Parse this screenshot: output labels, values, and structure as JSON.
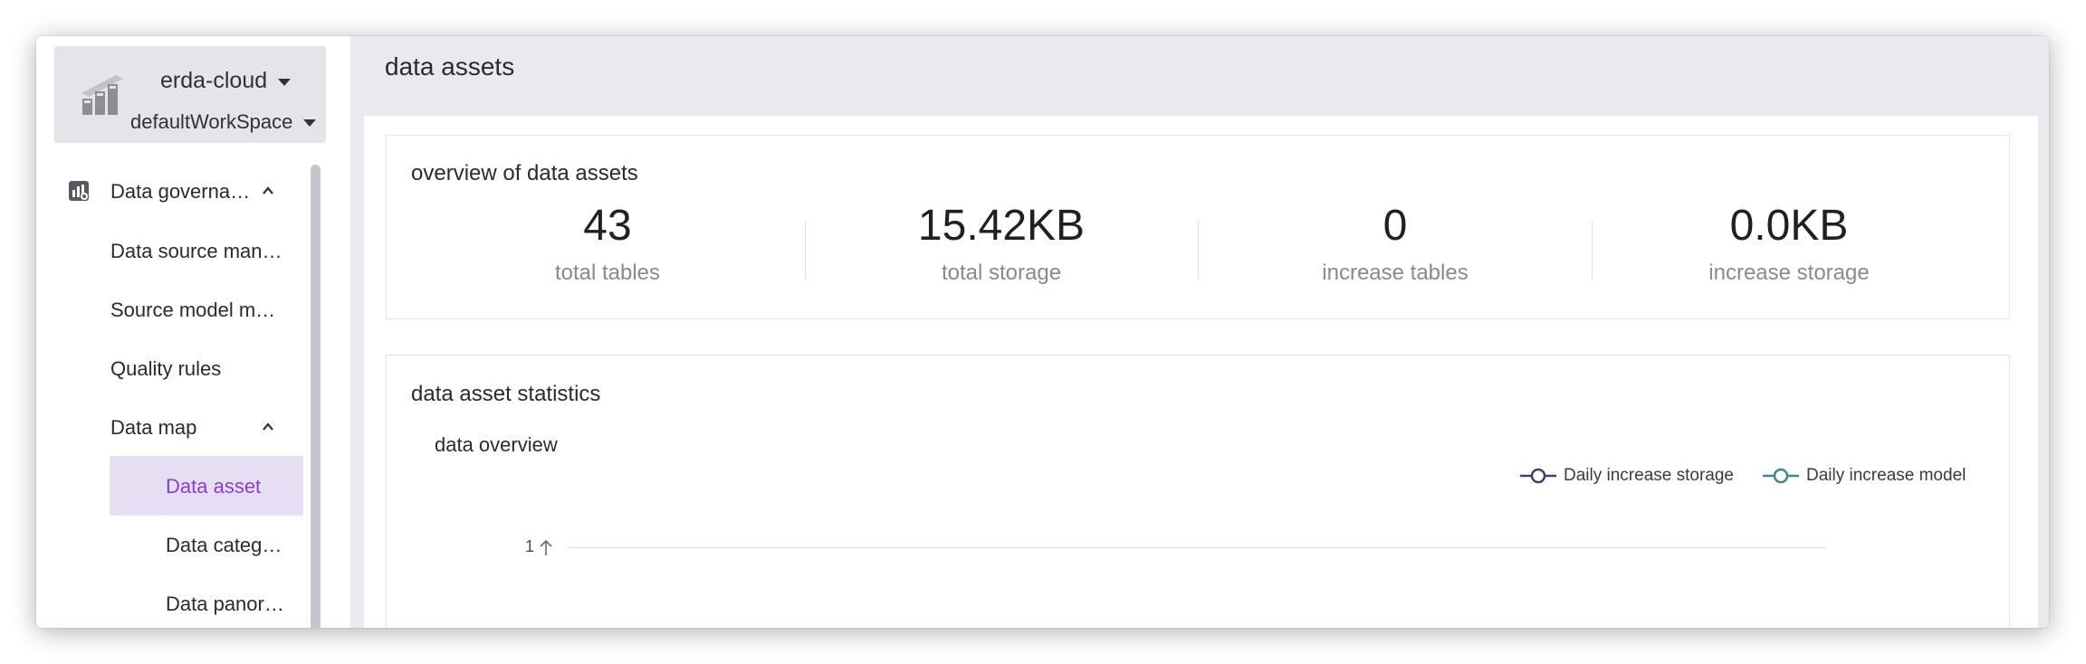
{
  "sidebar": {
    "org": {
      "name": "erda-cloud",
      "workspace": "defaultWorkSpace"
    },
    "menu": {
      "governance": "Data governa…",
      "source_management": "Data source man…",
      "source_model": "Source model m…",
      "quality_rules": "Quality rules",
      "data_map": "Data map",
      "data_asset": "Data asset",
      "data_category": "Data categ…",
      "data_panorama": "Data panor…"
    }
  },
  "main": {
    "title": "data assets",
    "overview": {
      "title": "overview of data assets",
      "stats": [
        {
          "value": "43",
          "label": "total tables"
        },
        {
          "value": "15.42KB",
          "label": "total storage"
        },
        {
          "value": "0",
          "label": "increase tables"
        },
        {
          "value": "0.0KB",
          "label": "increase storage"
        }
      ]
    },
    "statistics": {
      "title": "data asset statistics",
      "subtitle": "data overview"
    }
  },
  "chart_data": {
    "type": "line",
    "title": "data overview",
    "series": [
      {
        "name": "Daily increase storage",
        "values": []
      },
      {
        "name": "Daily increase model",
        "values": []
      }
    ],
    "y_tick_labels": [
      "1"
    ],
    "legend": "top-right"
  },
  "colors": {
    "accent": "#8a3ed6",
    "active_bg": "#e6dff3",
    "series_storage": "#3e3f7a",
    "series_model": "#3f8790"
  },
  "icons": {
    "logo": "chart-logo-icon",
    "governance": "governance-icon",
    "chevron": "chevron-up-icon",
    "caret": "caret-down-icon",
    "axis_arrow": "arrow-up-icon"
  }
}
